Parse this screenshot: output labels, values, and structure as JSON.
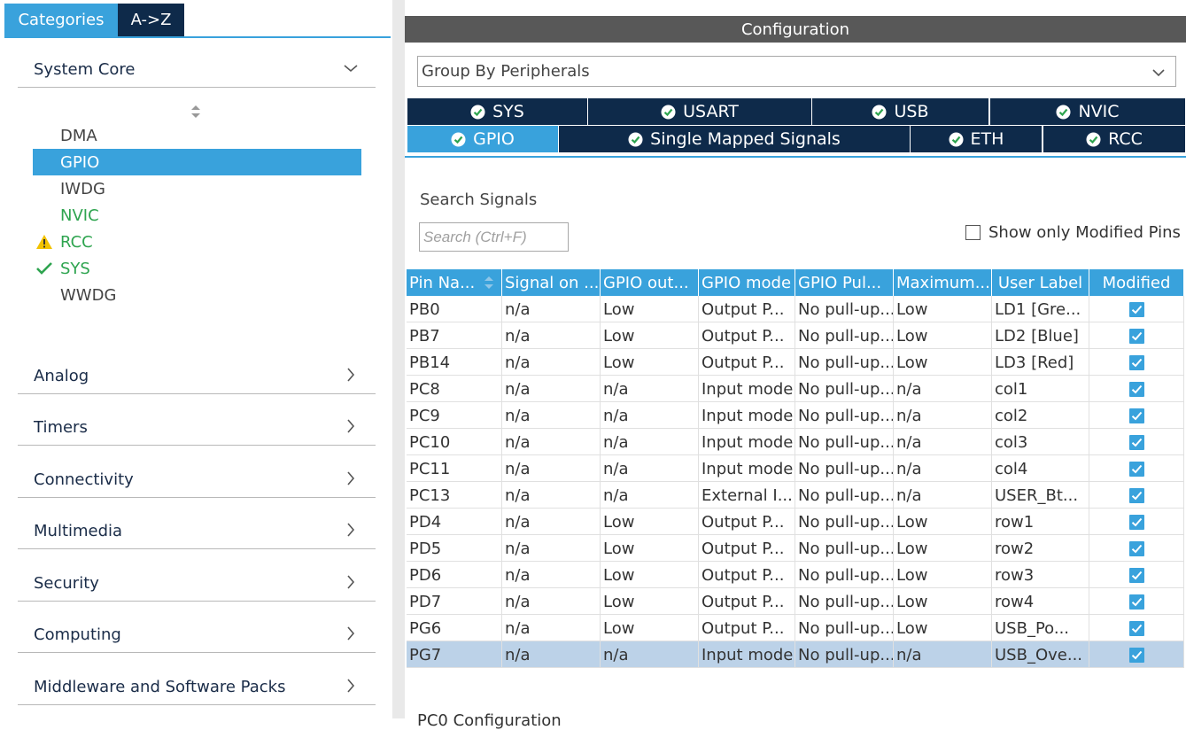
{
  "sidebar": {
    "tab_categories": "Categories",
    "tab_az": "A->Z",
    "system_core": {
      "label": "System Core",
      "items": [
        {
          "label": "DMA",
          "state": "normal"
        },
        {
          "label": "GPIO",
          "state": "selected"
        },
        {
          "label": "IWDG",
          "state": "normal"
        },
        {
          "label": "NVIC",
          "state": "green"
        },
        {
          "label": "RCC",
          "state": "green",
          "icon": "warning-icon"
        },
        {
          "label": "SYS",
          "state": "green",
          "icon": "checkmark-icon"
        },
        {
          "label": "WWDG",
          "state": "normal"
        }
      ]
    },
    "categories": [
      "Analog",
      "Timers",
      "Connectivity",
      "Multimedia",
      "Security",
      "Computing",
      "Middleware and Software Packs"
    ]
  },
  "config": {
    "title": "Configuration",
    "group_by": "Group By Peripherals",
    "tabs_row1": [
      "SYS",
      "USART",
      "USB",
      "NVIC"
    ],
    "tabs_row2": [
      "GPIO",
      "Single Mapped Signals",
      "ETH",
      "RCC"
    ],
    "active_tab": "GPIO",
    "search_label": "Search Signals",
    "search_placeholder": "Search (Ctrl+F)",
    "show_modified_label": "Show only Modified Pins"
  },
  "table": {
    "headers": [
      "Pin Na...",
      "Signal on ...",
      "GPIO out...",
      "GPIO mode",
      "GPIO Pul...",
      "Maximum...",
      "User Label",
      "Modified"
    ],
    "rows": [
      [
        "PB0",
        "n/a",
        "Low",
        "Output P...",
        "No pull-up...",
        "Low",
        "LD1 [Gre..."
      ],
      [
        "PB7",
        "n/a",
        "Low",
        "Output P...",
        "No pull-up...",
        "Low",
        "LD2 [Blue]"
      ],
      [
        "PB14",
        "n/a",
        "Low",
        "Output P...",
        "No pull-up...",
        "Low",
        "LD3 [Red]"
      ],
      [
        "PC8",
        "n/a",
        "n/a",
        "Input mode",
        "No pull-up...",
        "n/a",
        "col1"
      ],
      [
        "PC9",
        "n/a",
        "n/a",
        "Input mode",
        "No pull-up...",
        "n/a",
        "col2"
      ],
      [
        "PC10",
        "n/a",
        "n/a",
        "Input mode",
        "No pull-up...",
        "n/a",
        "col3"
      ],
      [
        "PC11",
        "n/a",
        "n/a",
        "Input mode",
        "No pull-up...",
        "n/a",
        "col4"
      ],
      [
        "PC13",
        "n/a",
        "n/a",
        "External I...",
        "No pull-up...",
        "n/a",
        "USER_Bt..."
      ],
      [
        "PD4",
        "n/a",
        "Low",
        "Output P...",
        "No pull-up...",
        "Low",
        "row1"
      ],
      [
        "PD5",
        "n/a",
        "Low",
        "Output P...",
        "No pull-up...",
        "Low",
        "row2"
      ],
      [
        "PD6",
        "n/a",
        "Low",
        "Output P...",
        "No pull-up...",
        "Low",
        "row3"
      ],
      [
        "PD7",
        "n/a",
        "Low",
        "Output P...",
        "No pull-up...",
        "Low",
        "row4"
      ],
      [
        "PG6",
        "n/a",
        "Low",
        "Output P...",
        "No pull-up...",
        "Low",
        "USB_Po..."
      ],
      [
        "PG7",
        "n/a",
        "n/a",
        "Input mode",
        "No pull-up...",
        "n/a",
        "USB_Ove..."
      ]
    ],
    "selected_row": 13
  },
  "bottom_text": "PC0 Configuration",
  "colors": {
    "accent": "#39a2dc",
    "dark_navy": "#0e2a4a",
    "header_gray": "#585858",
    "green": "#2ea44f",
    "warning": "#f2c200",
    "selected_row": "#bcd2e8"
  }
}
